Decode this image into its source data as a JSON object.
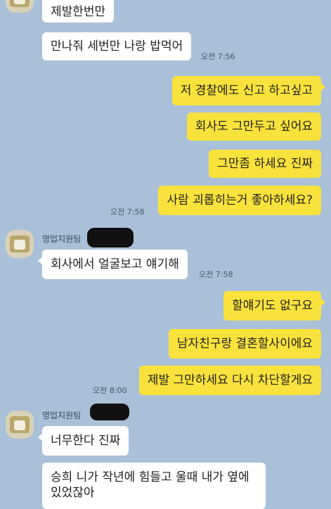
{
  "messages": {
    "m1": "제발한번만",
    "m2": "만나줘 세번만 나랑 밥먹어",
    "t1": "오전 7:56",
    "m3": "저 경찰에도 신고 하고싶고",
    "m4": "회사도 그만두고 싶어요",
    "m5": "그만좀 하세요 진짜",
    "m6": "사람 괴롭히는거 좋아하세요?",
    "t2": "오전 7:58",
    "sender1": "영업지원팀",
    "m7": "회사에서 얼굴보고 얘기해",
    "t3": "오전 7:58",
    "m8": "할얘기도 없구요",
    "m9": "남자친구랑 결혼할사이에요",
    "m10": "제발 그만하세요 다시 차단할게요",
    "t4": "오전 8:00",
    "sender2": "영업지원팀",
    "m11": "너무한다 진짜",
    "m12_line1": "승희 니가 작년에 힘들고 울때 내가 옆에",
    "m12_line2": "있었잖아"
  },
  "colors": {
    "background": "#a9c0d8",
    "incoming_bubble": "#ffffff",
    "outgoing_bubble": "#f9e23b"
  }
}
